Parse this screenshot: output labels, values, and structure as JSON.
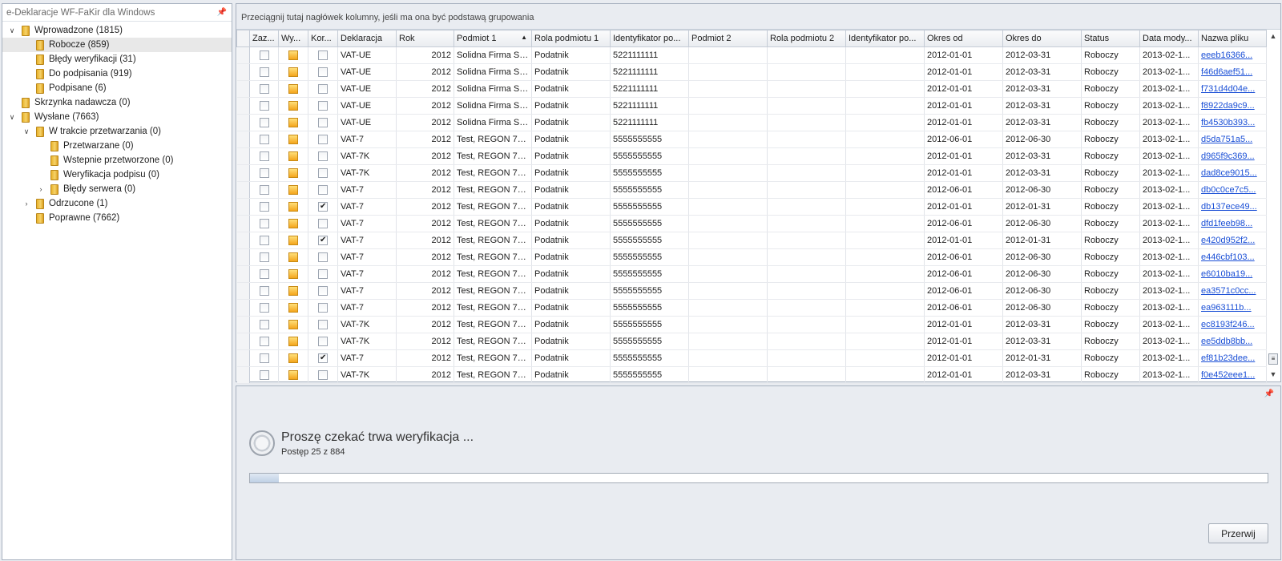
{
  "window": {
    "panel_title": "e-Deklaracje WF-FaKir dla Windows"
  },
  "tree": [
    {
      "label": "Wprowadzone (1815)",
      "level": 0,
      "expander": "expanded",
      "selected": false
    },
    {
      "label": "Robocze (859)",
      "level": 1,
      "expander": "none",
      "selected": true
    },
    {
      "label": "Błędy weryfikacji (31)",
      "level": 1,
      "expander": "none",
      "selected": false
    },
    {
      "label": "Do podpisania (919)",
      "level": 1,
      "expander": "none",
      "selected": false
    },
    {
      "label": "Podpisane (6)",
      "level": 1,
      "expander": "none",
      "selected": false
    },
    {
      "label": "Skrzynka nadawcza (0)",
      "level": 0,
      "expander": "none",
      "selected": false
    },
    {
      "label": "Wysłane (7663)",
      "level": 0,
      "expander": "expanded",
      "selected": false
    },
    {
      "label": "W trakcie przetwarzania (0)",
      "level": 1,
      "expander": "expanded",
      "selected": false
    },
    {
      "label": "Przetwarzane (0)",
      "level": 2,
      "expander": "none",
      "selected": false
    },
    {
      "label": "Wstepnie przetworzone (0)",
      "level": 2,
      "expander": "none",
      "selected": false
    },
    {
      "label": "Weryfikacja podpisu (0)",
      "level": 2,
      "expander": "none",
      "selected": false
    },
    {
      "label": "Błędy serwera (0)",
      "level": 2,
      "expander": "collapsed",
      "selected": false
    },
    {
      "label": "Odrzucone (1)",
      "level": 1,
      "expander": "collapsed",
      "selected": false
    },
    {
      "label": "Poprawne (7662)",
      "level": 1,
      "expander": "none",
      "selected": false
    }
  ],
  "grid": {
    "group_hint": "Przeciągnij tutaj nagłówek kolumny, jeśli ma ona być podstawą grupowania",
    "columns": [
      "Zaz...",
      "Wy...",
      "Kor...",
      "Deklaracja",
      "Rok",
      "Podmiot 1",
      "Rola podmiotu 1",
      "Identyfikator po...",
      "Podmiot 2",
      "Rola podmiotu 2",
      "Identyfikator po...",
      "Okres od",
      "Okres do",
      "Status",
      "Data mody...",
      "Nazwa pliku"
    ],
    "sorted_column": "Podmiot 1",
    "rows": [
      {
        "kor": false,
        "deklaracja": "VAT-UE",
        "rok": "2012",
        "podmiot1": "Solidna Firma Sp...",
        "rola1": "Podatnik",
        "id1": "5221111111",
        "podmiot2": "",
        "rola2": "",
        "id2": "",
        "od": "2012-01-01",
        "do": "2012-03-31",
        "status": "Roboczy",
        "data": "2013-02-1...",
        "plik": "eeeb16366..."
      },
      {
        "kor": false,
        "deklaracja": "VAT-UE",
        "rok": "2012",
        "podmiot1": "Solidna Firma Sp...",
        "rola1": "Podatnik",
        "id1": "5221111111",
        "podmiot2": "",
        "rola2": "",
        "id2": "",
        "od": "2012-01-01",
        "do": "2012-03-31",
        "status": "Roboczy",
        "data": "2013-02-1...",
        "plik": "f46d6aef51..."
      },
      {
        "kor": false,
        "deklaracja": "VAT-UE",
        "rok": "2012",
        "podmiot1": "Solidna Firma Sp...",
        "rola1": "Podatnik",
        "id1": "5221111111",
        "podmiot2": "",
        "rola2": "",
        "id2": "",
        "od": "2012-01-01",
        "do": "2012-03-31",
        "status": "Roboczy",
        "data": "2013-02-1...",
        "plik": "f731d4d04e..."
      },
      {
        "kor": false,
        "deklaracja": "VAT-UE",
        "rok": "2012",
        "podmiot1": "Solidna Firma Sp...",
        "rola1": "Podatnik",
        "id1": "5221111111",
        "podmiot2": "",
        "rola2": "",
        "id2": "",
        "od": "2012-01-01",
        "do": "2012-03-31",
        "status": "Roboczy",
        "data": "2013-02-1...",
        "plik": "f8922da9c9..."
      },
      {
        "kor": false,
        "deklaracja": "VAT-UE",
        "rok": "2012",
        "podmiot1": "Solidna Firma Sp...",
        "rola1": "Podatnik",
        "id1": "5221111111",
        "podmiot2": "",
        "rola2": "",
        "id2": "",
        "od": "2012-01-01",
        "do": "2012-03-31",
        "status": "Roboczy",
        "data": "2013-02-1...",
        "plik": "fb4530b393..."
      },
      {
        "kor": false,
        "deklaracja": "VAT-7",
        "rok": "2012",
        "podmiot1": "Test, REGON 77...",
        "rola1": "Podatnik",
        "id1": "5555555555",
        "podmiot2": "",
        "rola2": "",
        "id2": "",
        "od": "2012-06-01",
        "do": "2012-06-30",
        "status": "Roboczy",
        "data": "2013-02-1...",
        "plik": "d5da751a5..."
      },
      {
        "kor": false,
        "deklaracja": "VAT-7K",
        "rok": "2012",
        "podmiot1": "Test, REGON 77...",
        "rola1": "Podatnik",
        "id1": "5555555555",
        "podmiot2": "",
        "rola2": "",
        "id2": "",
        "od": "2012-01-01",
        "do": "2012-03-31",
        "status": "Roboczy",
        "data": "2013-02-1...",
        "plik": "d965f9c369..."
      },
      {
        "kor": false,
        "deklaracja": "VAT-7K",
        "rok": "2012",
        "podmiot1": "Test, REGON 77...",
        "rola1": "Podatnik",
        "id1": "5555555555",
        "podmiot2": "",
        "rola2": "",
        "id2": "",
        "od": "2012-01-01",
        "do": "2012-03-31",
        "status": "Roboczy",
        "data": "2013-02-1...",
        "plik": "dad8ce9015..."
      },
      {
        "kor": false,
        "deklaracja": "VAT-7",
        "rok": "2012",
        "podmiot1": "Test, REGON 77...",
        "rola1": "Podatnik",
        "id1": "5555555555",
        "podmiot2": "",
        "rola2": "",
        "id2": "",
        "od": "2012-06-01",
        "do": "2012-06-30",
        "status": "Roboczy",
        "data": "2013-02-1...",
        "plik": "db0c0ce7c5..."
      },
      {
        "kor": true,
        "deklaracja": "VAT-7",
        "rok": "2012",
        "podmiot1": "Test, REGON 77...",
        "rola1": "Podatnik",
        "id1": "5555555555",
        "podmiot2": "",
        "rola2": "",
        "id2": "",
        "od": "2012-01-01",
        "do": "2012-01-31",
        "status": "Roboczy",
        "data": "2013-02-1...",
        "plik": "db137ece49..."
      },
      {
        "kor": false,
        "deklaracja": "VAT-7",
        "rok": "2012",
        "podmiot1": "Test, REGON 77...",
        "rola1": "Podatnik",
        "id1": "5555555555",
        "podmiot2": "",
        "rola2": "",
        "id2": "",
        "od": "2012-06-01",
        "do": "2012-06-30",
        "status": "Roboczy",
        "data": "2013-02-1...",
        "plik": "dfd1feeb98..."
      },
      {
        "kor": true,
        "deklaracja": "VAT-7",
        "rok": "2012",
        "podmiot1": "Test, REGON 77...",
        "rola1": "Podatnik",
        "id1": "5555555555",
        "podmiot2": "",
        "rola2": "",
        "id2": "",
        "od": "2012-01-01",
        "do": "2012-01-31",
        "status": "Roboczy",
        "data": "2013-02-1...",
        "plik": "e420d952f2..."
      },
      {
        "kor": false,
        "deklaracja": "VAT-7",
        "rok": "2012",
        "podmiot1": "Test, REGON 77...",
        "rola1": "Podatnik",
        "id1": "5555555555",
        "podmiot2": "",
        "rola2": "",
        "id2": "",
        "od": "2012-06-01",
        "do": "2012-06-30",
        "status": "Roboczy",
        "data": "2013-02-1...",
        "plik": "e446cbf103..."
      },
      {
        "kor": false,
        "deklaracja": "VAT-7",
        "rok": "2012",
        "podmiot1": "Test, REGON 77...",
        "rola1": "Podatnik",
        "id1": "5555555555",
        "podmiot2": "",
        "rola2": "",
        "id2": "",
        "od": "2012-06-01",
        "do": "2012-06-30",
        "status": "Roboczy",
        "data": "2013-02-1...",
        "plik": "e6010ba19..."
      },
      {
        "kor": false,
        "deklaracja": "VAT-7",
        "rok": "2012",
        "podmiot1": "Test, REGON 77...",
        "rola1": "Podatnik",
        "id1": "5555555555",
        "podmiot2": "",
        "rola2": "",
        "id2": "",
        "od": "2012-06-01",
        "do": "2012-06-30",
        "status": "Roboczy",
        "data": "2013-02-1...",
        "plik": "ea3571c0cc..."
      },
      {
        "kor": false,
        "deklaracja": "VAT-7",
        "rok": "2012",
        "podmiot1": "Test, REGON 77...",
        "rola1": "Podatnik",
        "id1": "5555555555",
        "podmiot2": "",
        "rola2": "",
        "id2": "",
        "od": "2012-06-01",
        "do": "2012-06-30",
        "status": "Roboczy",
        "data": "2013-02-1...",
        "plik": "ea963111b..."
      },
      {
        "kor": false,
        "deklaracja": "VAT-7K",
        "rok": "2012",
        "podmiot1": "Test, REGON 77...",
        "rola1": "Podatnik",
        "id1": "5555555555",
        "podmiot2": "",
        "rola2": "",
        "id2": "",
        "od": "2012-01-01",
        "do": "2012-03-31",
        "status": "Roboczy",
        "data": "2013-02-1...",
        "plik": "ec8193f246..."
      },
      {
        "kor": false,
        "deklaracja": "VAT-7K",
        "rok": "2012",
        "podmiot1": "Test, REGON 77...",
        "rola1": "Podatnik",
        "id1": "5555555555",
        "podmiot2": "",
        "rola2": "",
        "id2": "",
        "od": "2012-01-01",
        "do": "2012-03-31",
        "status": "Roboczy",
        "data": "2013-02-1...",
        "plik": "ee5ddb8bb..."
      },
      {
        "kor": true,
        "deklaracja": "VAT-7",
        "rok": "2012",
        "podmiot1": "Test, REGON 77...",
        "rola1": "Podatnik",
        "id1": "5555555555",
        "podmiot2": "",
        "rola2": "",
        "id2": "",
        "od": "2012-01-01",
        "do": "2012-01-31",
        "status": "Roboczy",
        "data": "2013-02-1...",
        "plik": "ef81b23dee..."
      },
      {
        "kor": false,
        "deklaracja": "VAT-7K",
        "rok": "2012",
        "podmiot1": "Test, REGON 77...",
        "rola1": "Podatnik",
        "id1": "5555555555",
        "podmiot2": "",
        "rola2": "",
        "id2": "",
        "od": "2012-01-01",
        "do": "2012-03-31",
        "status": "Roboczy",
        "data": "2013-02-1...",
        "plik": "f0e452eee1..."
      }
    ]
  },
  "progress": {
    "title": "Proszę czekać trwa weryfikacja ...",
    "subtitle": "Postęp 25 z 884",
    "current": 25,
    "total": 884,
    "stop_label": "Przerwij"
  },
  "colors": {
    "link": "#1a4fd6",
    "folder": "#f2c24a",
    "state_icon": "#f4a51c"
  },
  "icons": {
    "folder": "folder-icon",
    "pin": "pin-icon",
    "sort": "sort-ascending-icon",
    "spinner": "spinner-icon"
  }
}
